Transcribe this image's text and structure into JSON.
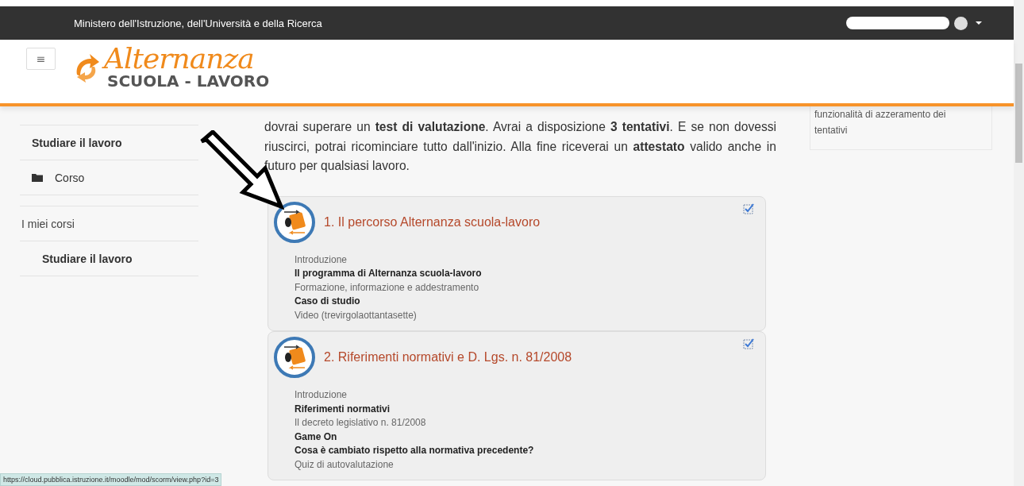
{
  "top_bar": {
    "title": "Ministero dell'Istruzione, dell'Università e della Ricerca"
  },
  "header": {
    "menu_button": "≡",
    "logo_script": "Alternanza",
    "logo_sub": "SCUOLA - LAVORO"
  },
  "sidebar": {
    "blocks": [
      {
        "items": [
          {
            "label": "Studiare il lavoro",
            "kind": "heading"
          },
          {
            "label": "Corso",
            "kind": "folder"
          }
        ]
      },
      {
        "items": [
          {
            "label": "I miei corsi",
            "kind": "plain",
            "children": [
              {
                "label": "Studiare il lavoro",
                "kind": "heading"
              }
            ]
          }
        ]
      }
    ]
  },
  "intro": {
    "text": "dovrai superare un **test di valutazione**. Avrai a disposizione **3 tentativi**. E se non dovessi riuscirci, potrai ricominciare tutto dall'inizio. Alla fine riceverai un **attestato** valido anche in futuro per qualsiasi lavoro."
  },
  "sections": [
    {
      "title": "1. Il percorso Alternanza scuola-lavoro",
      "completed": true,
      "items": [
        {
          "text": "Introduzione",
          "kind": "label"
        },
        {
          "text": "Il programma di Alternanza scuola-lavoro",
          "kind": "activity"
        },
        {
          "text": "Formazione, informazione e addestramento",
          "kind": "label"
        },
        {
          "text": "Caso di studio",
          "kind": "activity"
        },
        {
          "text": "Video (trevirgolaottantasette)",
          "kind": "label"
        }
      ]
    },
    {
      "title": "2. Riferimenti normativi e D. Lgs. n. 81/2008",
      "completed": true,
      "items": [
        {
          "text": "Introduzione",
          "kind": "label"
        },
        {
          "text": "Riferimenti normativi",
          "kind": "activity"
        },
        {
          "text": "Il decreto legislativo n. 81/2008",
          "kind": "label"
        },
        {
          "text": "Game On",
          "kind": "activity"
        },
        {
          "text": "Cosa è cambiato rispetto alla normativa precedente?",
          "kind": "activity"
        },
        {
          "text": "Quiz di autovalutazione",
          "kind": "label"
        }
      ]
    }
  ],
  "right_block": {
    "text": "funzionalità di azzeramento dei tentativi"
  },
  "status_url": "https://cloud.pubblica.istruzione.it/moodle/mod/scorm/view.php?id=3"
}
